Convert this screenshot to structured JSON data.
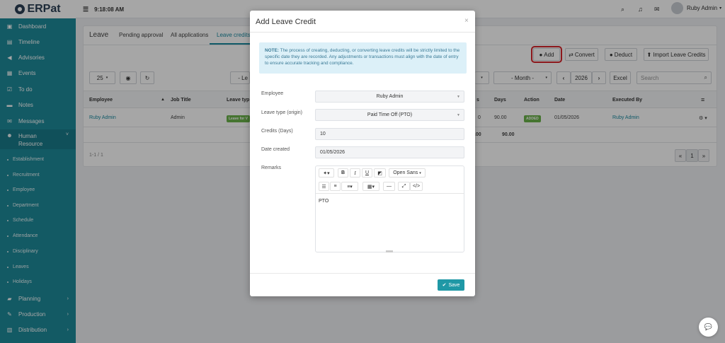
{
  "app": {
    "logo": "ERPat"
  },
  "topbar": {
    "time": "9:18:08 AM",
    "user": "Ruby Admin"
  },
  "sidebar": {
    "items": [
      {
        "label": "Dashboard",
        "icon": "dashboard-icon"
      },
      {
        "label": "Timeline",
        "icon": "timeline-icon"
      },
      {
        "label": "Advisories",
        "icon": "megaphone-icon"
      },
      {
        "label": "Events",
        "icon": "calendar-icon"
      },
      {
        "label": "To do",
        "icon": "checkbox-icon"
      },
      {
        "label": "Notes",
        "icon": "notes-icon"
      },
      {
        "label": "Messages",
        "icon": "envelope-icon"
      },
      {
        "label": "Human Resource",
        "icon": "users-icon"
      }
    ],
    "subitems": [
      "Establishment",
      "Recruitment",
      "Employee",
      "Department",
      "Schedule",
      "Attendance",
      "Disciplinary",
      "Leaves",
      "Holidays"
    ],
    "bottom": [
      {
        "label": "Planning",
        "icon": "briefcase-icon"
      },
      {
        "label": "Production",
        "icon": "gavel-icon"
      },
      {
        "label": "Distribution",
        "icon": "bank-icon"
      }
    ]
  },
  "page": {
    "tabs": [
      "Leave",
      "Pending approval",
      "All applications",
      "Leave credits"
    ],
    "buttons": {
      "add": "Add",
      "convert": "Convert",
      "deduct": "Deduct",
      "import": "Import Leave Credits"
    },
    "filters": {
      "page_size": "25",
      "leave": "- Le",
      "month": "- Month -",
      "year": "2026",
      "excel": "Excel",
      "search_placeholder": "Search"
    },
    "table": {
      "headers": [
        "Employee",
        "Job Title",
        "Leave typ",
        "s",
        "Days",
        "Action",
        "Date",
        "Executed By"
      ],
      "row": {
        "employee": "Ruby Admin",
        "job": "Admin",
        "leave_badge": "Leave for V",
        "credits": "0",
        "days": "90.00",
        "action": "ADDED",
        "date": "01/05/2026",
        "executed_by": "Ruby Admin"
      },
      "totals": {
        "credits": "0.00",
        "days": "90.00"
      }
    },
    "pager": {
      "info": "1-1 / 1",
      "prev": "«",
      "page": "1",
      "next": "»"
    }
  },
  "modal": {
    "title": "Add Leave Credit",
    "close": "×",
    "note_label": "NOTE:",
    "note_text": "The process of creating, deducting, or converting leave credits will be strictly limited to the specific date they are recorded. Any adjustments or transactions must align with the date of entry to ensure accurate tracking and compliance.",
    "fields": {
      "employee_label": "Employee",
      "employee_value": "Ruby Admin",
      "leave_type_label": "Leave type (origin)",
      "leave_type_value": "Paid Time Off (PTO)",
      "credits_label": "Credits (Days)",
      "credits_value": "10",
      "date_label": "Date created",
      "date_value": "01/05/2026",
      "remarks_label": "Remarks",
      "remarks_value": "PTO"
    },
    "editor": {
      "font": "Open Sans"
    },
    "save": "Save"
  }
}
